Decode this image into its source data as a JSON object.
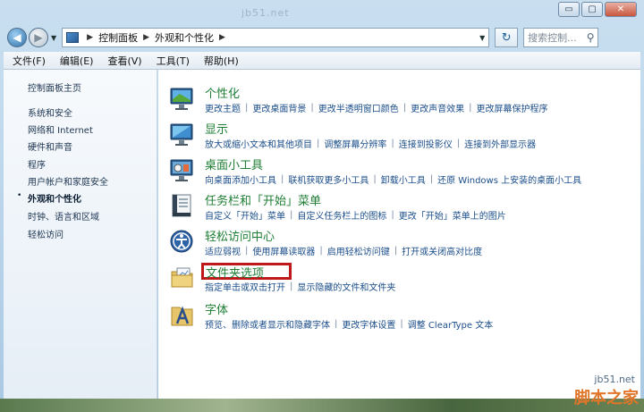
{
  "window": {
    "watermark": "jb51.net",
    "controls": {
      "minimize": "▭",
      "maximize": "▢",
      "close": "✕"
    }
  },
  "address": {
    "crumbs": [
      "控制面板",
      "外观和个性化"
    ],
    "search_placeholder": "搜索控制..."
  },
  "menu": [
    "文件(F)",
    "编辑(E)",
    "查看(V)",
    "工具(T)",
    "帮助(H)"
  ],
  "sidebar": {
    "items": [
      {
        "label": "控制面板主页"
      },
      {
        "label": "系统和安全"
      },
      {
        "label": "网络和 Internet"
      },
      {
        "label": "硬件和声音"
      },
      {
        "label": "程序"
      },
      {
        "label": "用户帐户和家庭安全"
      },
      {
        "label": "外观和个性化"
      },
      {
        "label": "时钟、语言和区域"
      },
      {
        "label": "轻松访问"
      }
    ]
  },
  "categories": [
    {
      "title": "个性化",
      "icon": "monitor-personalize-icon",
      "links": [
        "更改主题",
        "更改桌面背景",
        "更改半透明窗口颜色",
        "更改声音效果",
        "更改屏幕保护程序"
      ]
    },
    {
      "title": "显示",
      "icon": "display-icon",
      "links": [
        "放大或缩小文本和其他项目",
        "调整屏幕分辨率",
        "连接到投影仪",
        "连接到外部显示器"
      ]
    },
    {
      "title": "桌面小工具",
      "icon": "gadgets-icon",
      "links": [
        "向桌面添加小工具",
        "联机获取更多小工具",
        "卸载小工具",
        "还原 Windows 上安装的桌面小工具"
      ]
    },
    {
      "title": "任务栏和「开始」菜单",
      "icon": "taskbar-icon",
      "links": [
        "自定义「开始」菜单",
        "自定义任务栏上的图标",
        "更改「开始」菜单上的图片"
      ]
    },
    {
      "title": "轻松访问中心",
      "icon": "ease-of-access-icon",
      "links": [
        "适应弱视",
        "使用屏幕读取器",
        "启用轻松访问键",
        "打开或关闭高对比度"
      ]
    },
    {
      "title": "文件夹选项",
      "icon": "folder-options-icon",
      "links": [
        "指定单击或双击打开",
        "显示隐藏的文件和文件夹"
      ]
    },
    {
      "title": "字体",
      "icon": "fonts-icon",
      "links": [
        "预览、删除或者显示和隐藏字体",
        "更改字体设置",
        "调整 ClearType 文本"
      ]
    }
  ],
  "watermarks": {
    "site": "jb51.net",
    "brand": "脚本之家"
  },
  "colors": {
    "category_title": "#1e7e34",
    "link": "#1a4d8a",
    "highlight": "#c0171b"
  }
}
